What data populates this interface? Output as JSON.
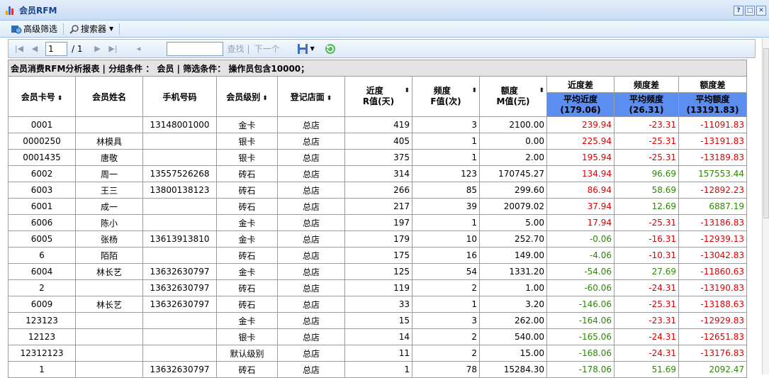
{
  "window": {
    "title": "会员RFM",
    "buttons": [
      "?",
      "□",
      "✕"
    ]
  },
  "toolbar": {
    "advanced_filter": "高级筛选",
    "search_tool": "搜索器"
  },
  "pager": {
    "page": "1",
    "total": "/ 1",
    "find": "查找",
    "next": "下一个"
  },
  "report": {
    "caption": "会员消费RFM分析报表 | 分组条件 ： 会员 | 筛选条件： 操作员包含10000；",
    "headers": {
      "card": "会员卡号",
      "name": "会员姓名",
      "phone": "手机号码",
      "level": "会员级别",
      "store": "登记店面",
      "r_line1": "近度",
      "r_line2": "R值(天)",
      "f_line1": "频度",
      "f_line2": "F值(次)",
      "m_line1": "额度",
      "m_line2": "M值(元)",
      "grp_r": "近度差",
      "grp_f": "频度差",
      "grp_m": "额度差",
      "avg_r1": "平均近度",
      "avg_r2": "(179.06)",
      "avg_f1": "平均频度",
      "avg_f2": "(26.31)",
      "avg_m1": "平均额度",
      "avg_m2": "(13191.83)"
    },
    "rows": [
      {
        "card": "0001",
        "name": "",
        "phone": "13148001000",
        "level": "金卡",
        "store": "总店",
        "r": "419",
        "f": "3",
        "m": "2100.00",
        "dr": "239.94",
        "df": "-23.31",
        "dm": "-11091.83"
      },
      {
        "card": "0000250",
        "name": "林模具",
        "phone": "",
        "level": "银卡",
        "store": "总店",
        "r": "405",
        "f": "1",
        "m": "0.00",
        "dr": "225.94",
        "df": "-25.31",
        "dm": "-13191.83"
      },
      {
        "card": "0001435",
        "name": "唐敬",
        "phone": "",
        "level": "银卡",
        "store": "总店",
        "r": "375",
        "f": "1",
        "m": "2.00",
        "dr": "195.94",
        "df": "-25.31",
        "dm": "-13189.83"
      },
      {
        "card": "6002",
        "name": "周一",
        "phone": "13557526268",
        "level": "砖石",
        "store": "总店",
        "r": "314",
        "f": "123",
        "m": "170745.27",
        "dr": "134.94",
        "df": "96.69",
        "dm": "157553.44"
      },
      {
        "card": "6003",
        "name": "王三",
        "phone": "13800138123",
        "level": "砖石",
        "store": "总店",
        "r": "266",
        "f": "85",
        "m": "299.60",
        "dr": "86.94",
        "df": "58.69",
        "dm": "-12892.23"
      },
      {
        "card": "6001",
        "name": "成一",
        "phone": "",
        "level": "砖石",
        "store": "总店",
        "r": "217",
        "f": "39",
        "m": "20079.02",
        "dr": "37.94",
        "df": "12.69",
        "dm": "6887.19"
      },
      {
        "card": "6006",
        "name": "陈小",
        "phone": "",
        "level": "金卡",
        "store": "总店",
        "r": "197",
        "f": "1",
        "m": "5.00",
        "dr": "17.94",
        "df": "-25.31",
        "dm": "-13186.83"
      },
      {
        "card": "6005",
        "name": "张杨",
        "phone": "13613913810",
        "level": "金卡",
        "store": "总店",
        "r": "179",
        "f": "10",
        "m": "252.70",
        "dr": "-0.06",
        "df": "-16.31",
        "dm": "-12939.13"
      },
      {
        "card": "6",
        "name": "陌陌",
        "phone": "",
        "level": "砖石",
        "store": "总店",
        "r": "175",
        "f": "16",
        "m": "149.00",
        "dr": "-4.06",
        "df": "-10.31",
        "dm": "-13042.83"
      },
      {
        "card": "6004",
        "name": "林长艺",
        "phone": "13632630797",
        "level": "金卡",
        "store": "总店",
        "r": "125",
        "f": "54",
        "m": "1331.20",
        "dr": "-54.06",
        "df": "27.69",
        "dm": "-11860.63"
      },
      {
        "card": "2",
        "name": "",
        "phone": "13632630797",
        "level": "砖石",
        "store": "总店",
        "r": "119",
        "f": "2",
        "m": "1.00",
        "dr": "-60.06",
        "df": "-24.31",
        "dm": "-13190.83"
      },
      {
        "card": "6009",
        "name": "林长艺",
        "phone": "13632630797",
        "level": "砖石",
        "store": "总店",
        "r": "33",
        "f": "1",
        "m": "3.20",
        "dr": "-146.06",
        "df": "-25.31",
        "dm": "-13188.63"
      },
      {
        "card": "123123",
        "name": "",
        "phone": "",
        "level": "金卡",
        "store": "总店",
        "r": "15",
        "f": "3",
        "m": "262.00",
        "dr": "-164.06",
        "df": "-23.31",
        "dm": "-12929.83"
      },
      {
        "card": "12123",
        "name": "",
        "phone": "",
        "level": "银卡",
        "store": "总店",
        "r": "14",
        "f": "2",
        "m": "540.00",
        "dr": "-165.06",
        "df": "-24.31",
        "dm": "-12651.83"
      },
      {
        "card": "12312123",
        "name": "",
        "phone": "",
        "level": "默认级别",
        "store": "总店",
        "r": "11",
        "f": "2",
        "m": "15.00",
        "dr": "-168.06",
        "df": "-24.31",
        "dm": "-13176.83"
      },
      {
        "card": "1",
        "name": "",
        "phone": "13632630797",
        "level": "砖石",
        "store": "总店",
        "r": "1",
        "f": "78",
        "m": "15284.30",
        "dr": "-178.06",
        "df": "51.69",
        "dm": "2092.47"
      }
    ]
  },
  "colors": {
    "positive": "#e00000",
    "negative": "#2a8a00",
    "avg_header": "#5b8ef0"
  }
}
